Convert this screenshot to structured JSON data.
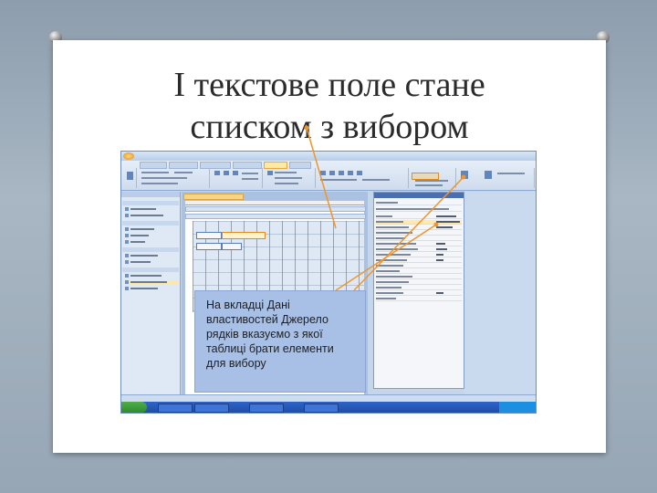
{
  "title": {
    "line1": "І текстове поле стане",
    "line2": "списком з вибором"
  },
  "callout": {
    "lines": [
      "На вкладці Дані",
      "властивостей Джерело",
      "рядків вказуємо з якої",
      "таблиці брати елементи",
      "для вибору"
    ]
  },
  "colors": {
    "background": "#a0afbe",
    "card": "#ffffff",
    "callout_fill": "#a8c0e6",
    "arrow": "#f0952b",
    "selection": "#e38a1d"
  },
  "icons": [
    "pushpin-icon",
    "access-office-button-icon",
    "start-button-icon"
  ]
}
